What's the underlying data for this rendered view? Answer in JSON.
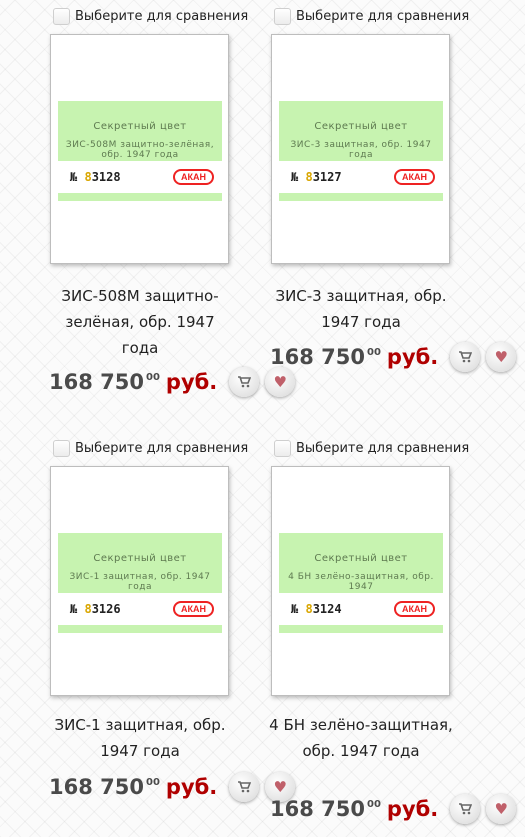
{
  "compare_label": "Выберите для сравнения",
  "currency": "руб.",
  "sample_title": "Секретный цвет",
  "brand": "АКАН",
  "products": [
    {
      "title": "ЗИС-508М защитно-зелёная, обр. 1947 года",
      "sample_subtitle": "ЗИС-508М защитно-зелёная, обр. 1947 года",
      "num_prefix": "№ ",
      "num_hl": "8",
      "num_rest": "3128",
      "price": "168 750",
      "kopecks": "00"
    },
    {
      "title": "ЗИС-3 защитная, обр. 1947 года",
      "sample_subtitle": "ЗИС-3 защитная, обр. 1947 года",
      "num_prefix": "№ ",
      "num_hl": "8",
      "num_rest": "3127",
      "price": "168 750",
      "kopecks": "00"
    },
    {
      "title": "ЗИС-1 защитная, обр. 1947 года",
      "sample_subtitle": "ЗИС-1 защитная, обр. 1947 года",
      "num_prefix": "№ ",
      "num_hl": "8",
      "num_rest": "3126",
      "price": "168 750",
      "kopecks": "00"
    },
    {
      "title": "4 БН зелёно-защитная, обр. 1947 года",
      "sample_subtitle": "4 БН зелёно-защитная, обр. 1947",
      "num_prefix": "№ ",
      "num_hl": "8",
      "num_rest": "3124",
      "price": "168 750",
      "kopecks": "00"
    }
  ]
}
